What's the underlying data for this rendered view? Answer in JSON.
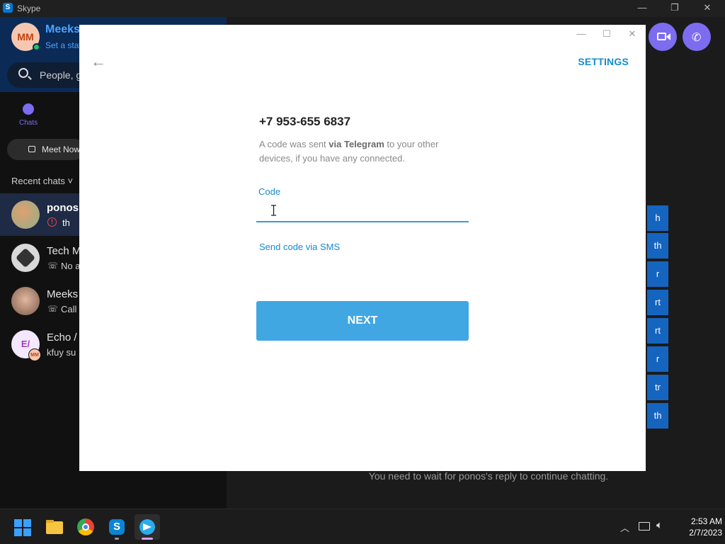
{
  "skype": {
    "window_title": "Skype",
    "profile": {
      "initials": "MM",
      "name": "Meeks",
      "status": "Set a stat"
    },
    "search_placeholder": "People, g",
    "chats_tab": "Chats",
    "meet_now": "Meet Now",
    "recent_label": "Recent chats ˅",
    "chats": [
      {
        "name": "ponos",
        "preview": "th",
        "status_icon": "alert-icon"
      },
      {
        "name": "Tech M",
        "preview": "No a",
        "status_icon": "call-icon"
      },
      {
        "name": "Meeks",
        "preview": "Call",
        "status_icon": "call-icon"
      },
      {
        "name": "Echo /",
        "preview": "kfuy su",
        "avatar_text": "E/",
        "badge": "MM"
      }
    ],
    "bubbles": [
      "h",
      "th",
      "r",
      "rt",
      "rt",
      "r",
      "tr",
      "th"
    ],
    "wait_message": "You need to wait for ponos's reply to continue chatting."
  },
  "telegram": {
    "settings_label": "SETTINGS",
    "phone": "+7 953-655 6837",
    "desc_prefix": "A code was sent ",
    "desc_bold": "via Telegram",
    "desc_suffix": " to your other devices, if you have any connected.",
    "code_label": "Code",
    "code_value": "",
    "sms_link": "Send code via SMS",
    "next_button": "NEXT"
  },
  "taskbar": {
    "time": "2:53 AM",
    "date": "2/7/2023",
    "apps": [
      "windows-start-icon",
      "file-explorer-icon",
      "chrome-icon",
      "skype-icon",
      "telegram-icon"
    ]
  },
  "colors": {
    "telegram_blue": "#40a7e3",
    "telegram_link": "#168acd",
    "skype_purple": "#7c6cf0",
    "bubble_blue": "#1565c0"
  }
}
